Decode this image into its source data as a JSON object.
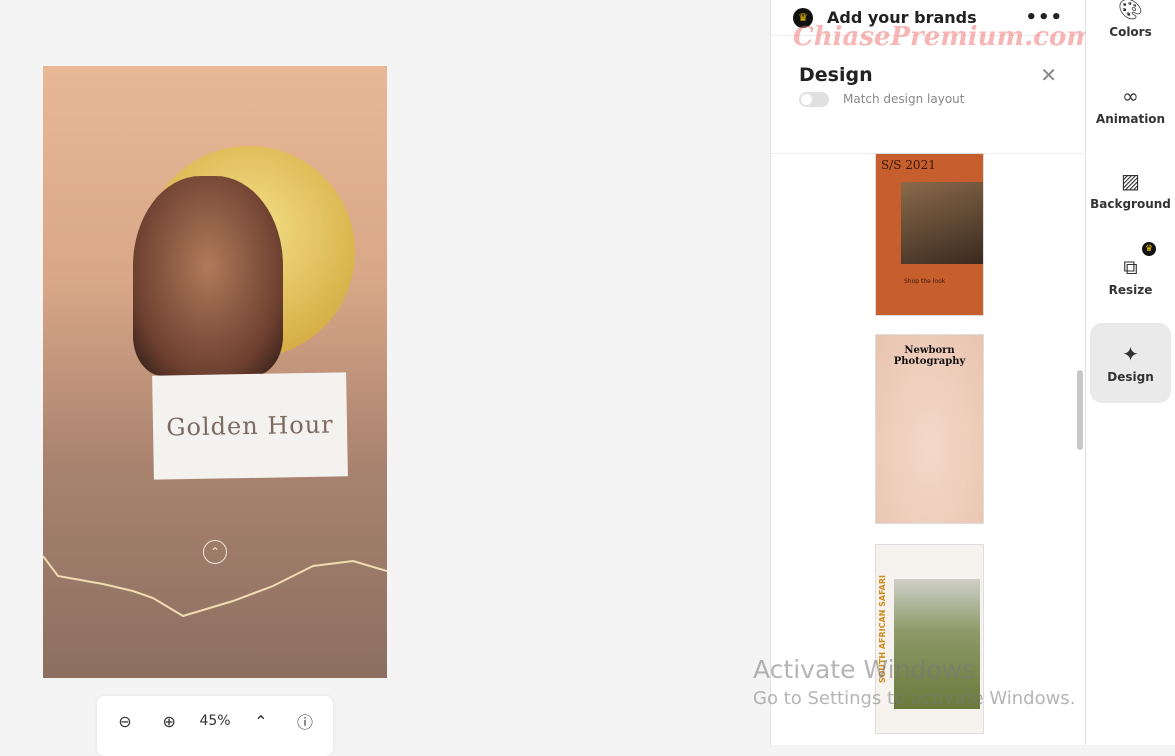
{
  "canvas": {
    "design_text": "Golden Hour",
    "zoom_level": "45%"
  },
  "panel": {
    "brands_title": "Add your brands",
    "watermark": "ChiasePremium.com",
    "title": "Design",
    "match_layout_label": "Match design layout",
    "match_layout_on": false,
    "templates": [
      {
        "title": "S/S 2021",
        "subtitle": "Shop the look"
      },
      {
        "title": "Newborn Photography"
      },
      {
        "title": "SOUTH AFRICAN SAFARI"
      }
    ]
  },
  "rail": [
    {
      "label": "Colors",
      "icon": "palette-icon"
    },
    {
      "label": "Animation",
      "icon": "animation-icon"
    },
    {
      "label": "Background",
      "icon": "background-icon"
    },
    {
      "label": "Resize",
      "icon": "resize-icon"
    },
    {
      "label": "Design",
      "icon": "magic-wand-icon",
      "active": true
    }
  ],
  "os_overlay": {
    "line1": "Activate Windows",
    "line2": "Go to Settings to activate Windows."
  },
  "colors": {
    "accent_crown": "#f5c400",
    "template_orange": "#c65f2d"
  }
}
